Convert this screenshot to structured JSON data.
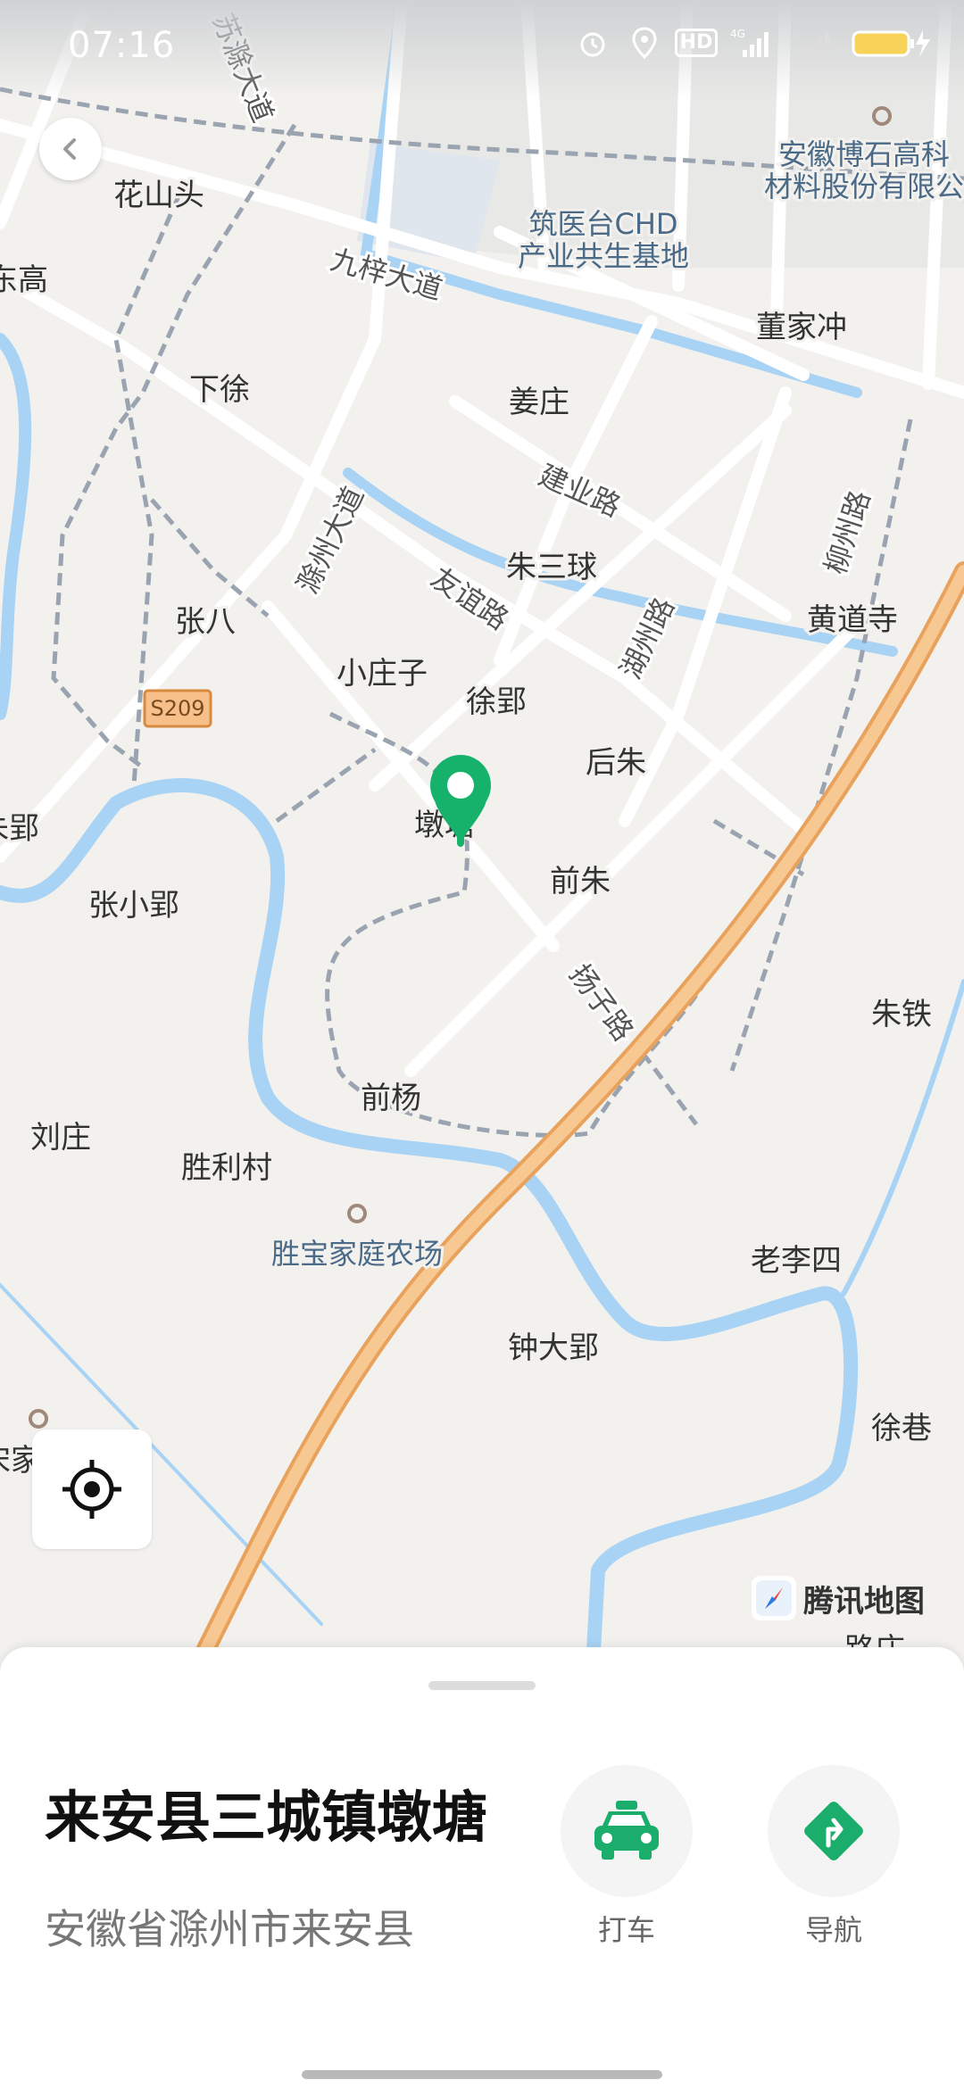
{
  "status_bar": {
    "time": "07:16",
    "network": "4G",
    "hd": "HD"
  },
  "map": {
    "labels": [
      {
        "text": "花山头"
      },
      {
        "text": "东高"
      },
      {
        "text": "下徐"
      },
      {
        "text": "姜庄"
      },
      {
        "text": "董家冲"
      },
      {
        "text": "朱三球"
      },
      {
        "text": "黄道寺"
      },
      {
        "text": "张八"
      },
      {
        "text": "小庄子"
      },
      {
        "text": "徐郢"
      },
      {
        "text": "后朱"
      },
      {
        "text": "墩塘"
      },
      {
        "text": "前朱"
      },
      {
        "text": "张小郢"
      },
      {
        "text": "朱郢"
      },
      {
        "text": "朱铁"
      },
      {
        "text": "前杨"
      },
      {
        "text": "刘庄"
      },
      {
        "text": "胜利村"
      },
      {
        "text": "老李四"
      },
      {
        "text": "钟大郢"
      },
      {
        "text": "徐巷"
      },
      {
        "text": "宋家"
      },
      {
        "text": "路庄"
      }
    ],
    "roads": [
      {
        "text": "苏滁大道"
      },
      {
        "text": "九梓大道"
      },
      {
        "text": "建业路"
      },
      {
        "text": "滁州大道"
      },
      {
        "text": "友谊路"
      },
      {
        "text": "湖州路"
      },
      {
        "text": "柳州路"
      },
      {
        "text": "扬子路"
      }
    ],
    "pois": [
      {
        "text": "安徽博石高科"
      },
      {
        "text": "材料股份有限公"
      },
      {
        "text": "筑医台CHD"
      },
      {
        "text": "产业共生基地"
      },
      {
        "text": "胜宝家庭农场"
      }
    ],
    "highway_badge": "S209",
    "brand": "腾讯地图"
  },
  "place": {
    "title": "来安县三城镇墩塘",
    "address": "安徽省滁州市来安县"
  },
  "actions": {
    "taxi_label": "打车",
    "navigate_label": "导航"
  },
  "colors": {
    "accent": "#1aad6b",
    "water": "#a8d3f5",
    "highway": "#f5b97a"
  }
}
